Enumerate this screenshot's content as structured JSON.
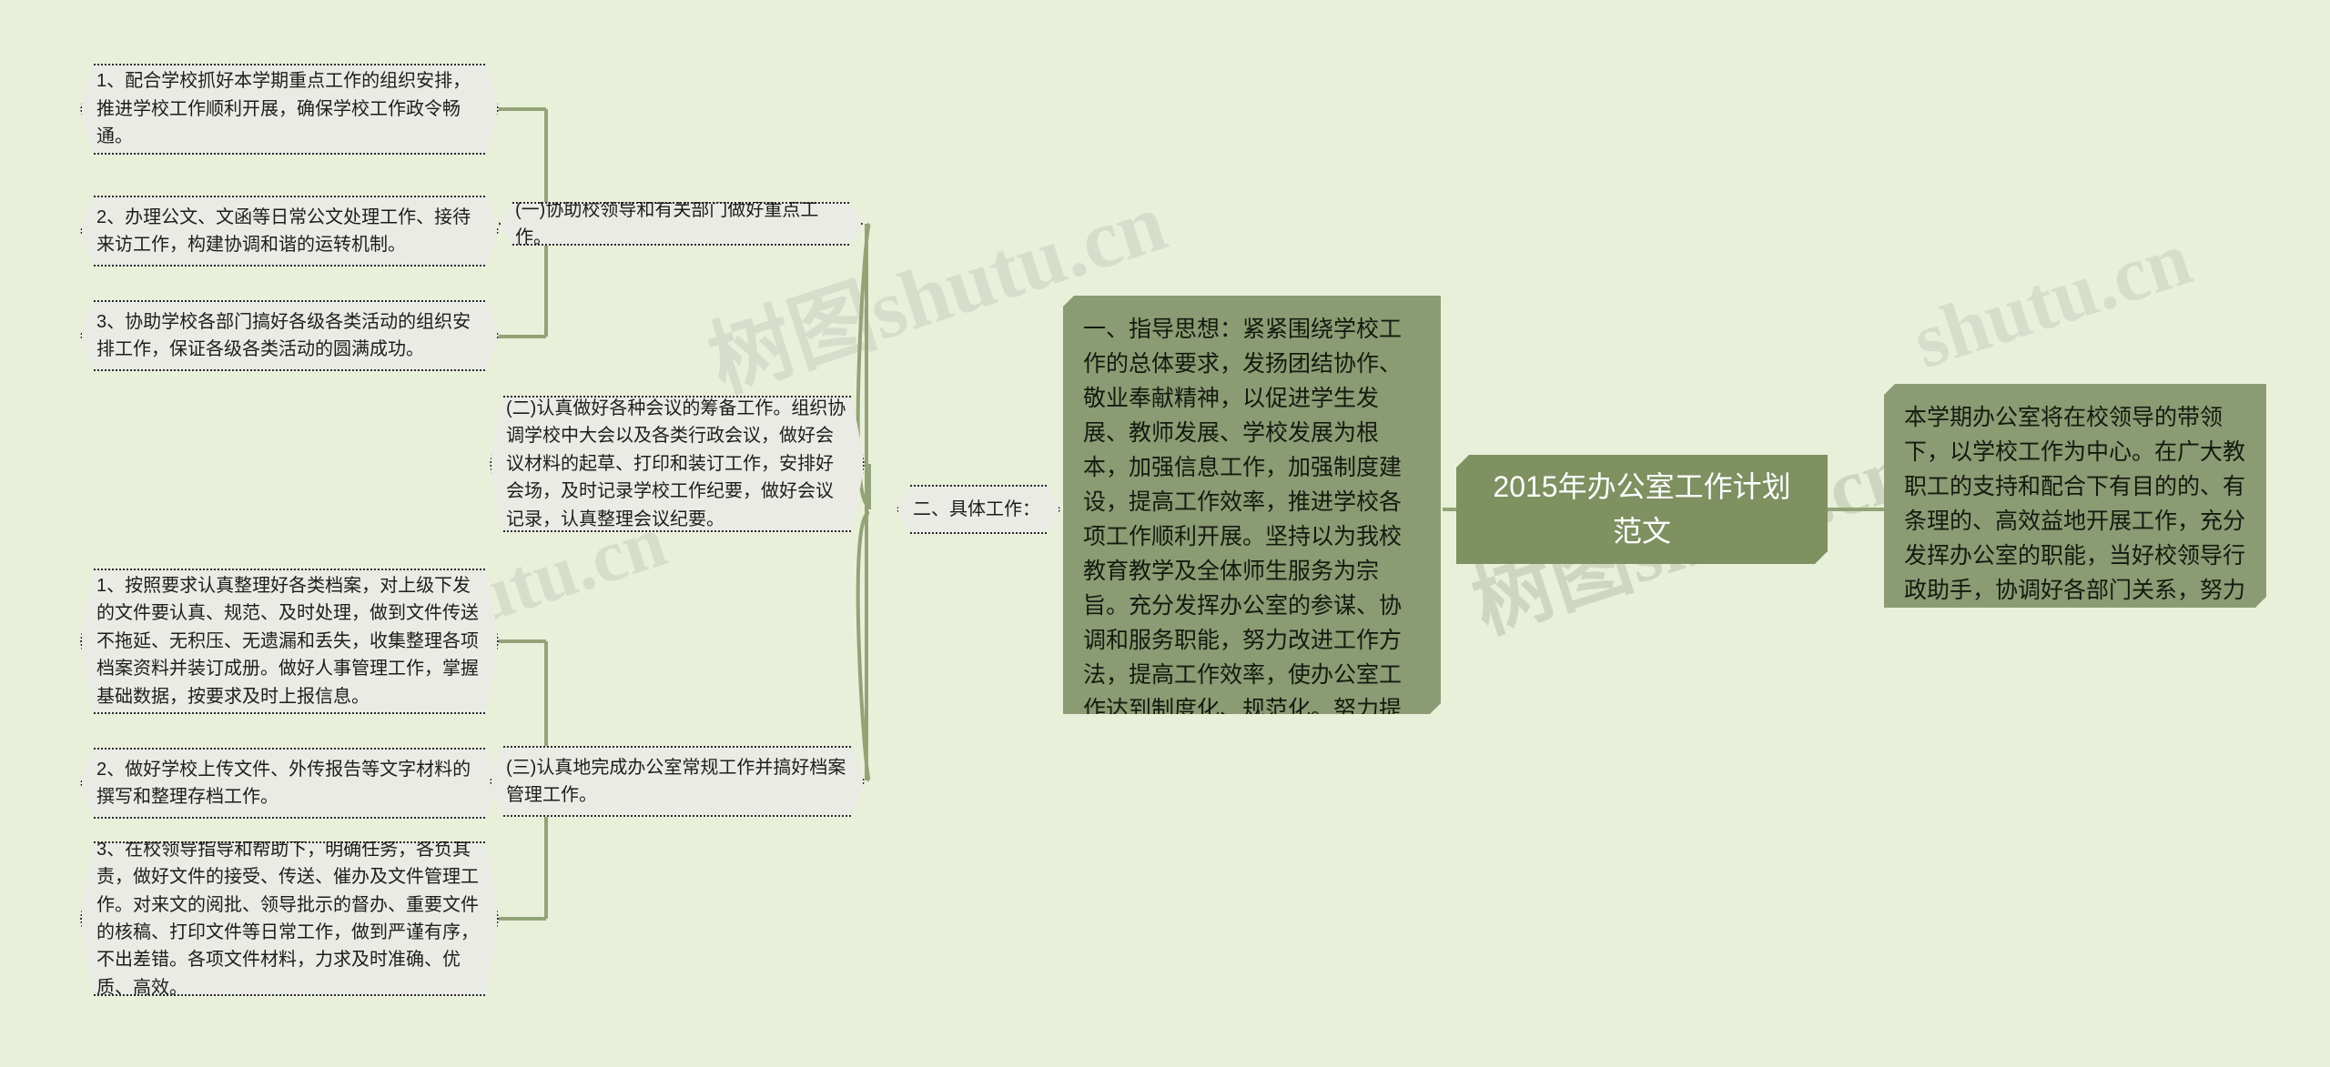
{
  "colors": {
    "background": "#e9f0da",
    "connector": "#93a377",
    "leaf_fill": "#ebebe5",
    "leaf_border": "#2a2a2a",
    "green_fill": "#8b9b73",
    "title_fill": "#7f9061",
    "title_text": "#ffffff"
  },
  "watermarks": {
    "w1": "树图shutu.cn",
    "w2": "shutu.cn",
    "w3": "树图shutu.cn",
    "w4": "shutu.cn"
  },
  "title": {
    "text": "2015年办公室工作计划范文"
  },
  "center": {
    "guiding_thought": "一、指导思想：紧紧围绕学校工作的总体要求，发扬团结协作、敬业奉献精神，以促进学生发展、教师发展、学校发展为根本，加强信息工作，加强制度建设，提高工作效率，推进学校各项工作顺利开展。坚持以为我校教育教学及全体师生服务为宗旨。充分发挥办公室的参谋、协调和服务职能，努力改进工作方法，提高工作效率，使办公室工作达到制度化、规范化。努力提高办公室成员的整体素质和服务意识。"
  },
  "right": {
    "summary": "本学期办公室将在校领导的带领下，以学校工作为中心。在广大教职工的支持和配合下有目的的、有条理的、高效益地开展工作，充分发挥办公室的职能，当好校领导行政助手，协调好各部门关系，努力做好服务工作。"
  },
  "branch": {
    "label": "二、具体工作："
  },
  "sections": [
    {
      "id": "one",
      "label": "(一)协助校领导和有关部门做好重点工作。",
      "items": [
        "1、配合学校抓好本学期重点工作的组织安排，推进学校工作顺利开展，确保学校工作政令畅通。",
        "2、办理公文、文函等日常公文处理工作、接待来访工作，构建协调和谐的运转机制。",
        "3、协助学校各部门搞好各级各类活动的组织安排工作，保证各级各类活动的圆满成功。"
      ]
    },
    {
      "id": "two",
      "label": "(二)认真做好各种会议的筹备工作。组织协调学校中大会以及各类行政会议，做好会议材料的起草、打印和装订工作，安排好会场，及时记录学校工作纪要，做好会议记录，认真整理会议纪要。",
      "items": []
    },
    {
      "id": "three",
      "label": "(三)认真地完成办公室常规工作并搞好档案管理工作。",
      "items": [
        "1、按照要求认真整理好各类档案，对上级下发的文件要认真、规范、及时处理，做到文件传送不拖延、无积压、无遗漏和丢失，收集整理各项档案资料并装订成册。做好人事管理工作，掌握基础数据，按要求及时上报信息。",
        "2、做好学校上传文件、外传报告等文字材料的撰写和整理存档工作。",
        "3、在校领导指导和帮助下，明确任务，各负其责，做好文件的接受、传送、催办及文件管理工作。对来文的阅批、领导批示的督办、重要文件的核稿、打印文件等日常工作，做到严谨有序，不出差错。各项文件材料，力求及时准确、优质、高效。"
      ]
    }
  ]
}
